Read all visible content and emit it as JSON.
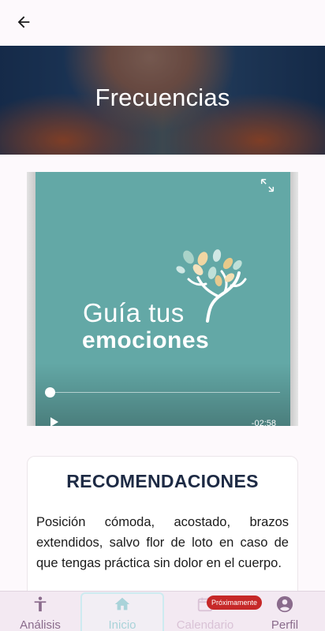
{
  "header": {
    "back_icon": "arrow-left-icon",
    "title": "Frecuencias"
  },
  "video": {
    "logo_line1": "Guía tus",
    "logo_line2": "emociones",
    "time_remaining": "-02:58",
    "progress": 0,
    "background_color": "#63a8a6"
  },
  "recommendations": {
    "title": "RECOMENDACIONES",
    "text": "Posición cómoda, acostado, brazos extendidos, salvo flor de loto en caso de que tengas práctica sin dolor en el cuerpo."
  },
  "bottom_nav": {
    "items": [
      {
        "label": "Análisis",
        "icon": "person-icon"
      },
      {
        "label": "Inicio",
        "icon": "home-icon",
        "active": true
      },
      {
        "label": "Calendario",
        "icon": "calendar-icon",
        "disabled": true,
        "badge": "Próximamente"
      },
      {
        "label": "Perfil",
        "icon": "account-circle-icon"
      }
    ]
  },
  "colors": {
    "accent": "#8a6b8c",
    "active_tab": "#a9d3d9",
    "badge": "#c62828",
    "title_text": "#1d2a44"
  }
}
